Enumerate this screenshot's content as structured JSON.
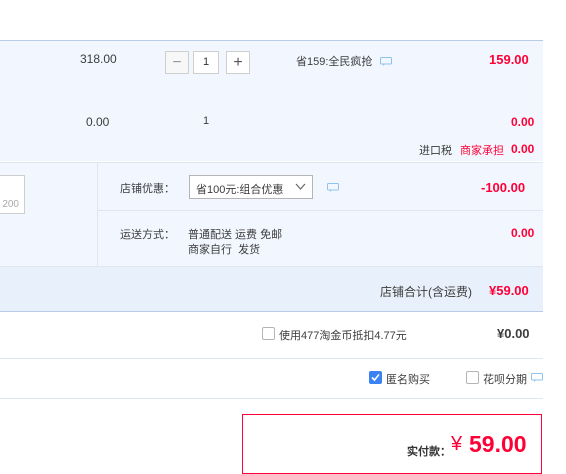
{
  "item1": {
    "orig_price": "318.00",
    "qty": "1",
    "promo": "省159:全民疯抢",
    "subtotal": "159.00"
  },
  "item2": {
    "price": "0.00",
    "qty": "1",
    "subtotal": "0.00",
    "tax_label": "进口税",
    "tax_note": "商家承担",
    "tax_value": "0.00"
  },
  "shop": {
    "partial_input_text": "200",
    "discount_label": "店铺优惠：",
    "discount_option": "省100元:组合优惠",
    "discount_value": "-100.00",
    "shipping_label": "运送方式：",
    "shipping_line1": "普通配送 运费 免邮",
    "shipping_line2": "商家自行  发货",
    "shipping_value": "0.00",
    "total_label": "店铺合计(含运费)",
    "total_value": "¥59.00"
  },
  "coins": {
    "label": "使用477淘金币抵扣4.77元",
    "value": "¥0.00"
  },
  "options": {
    "anonymous_label": "匿名购买",
    "anonymous_checked": true,
    "huabei_label": "花呗分期",
    "huabei_checked": false
  },
  "payment": {
    "label": "实付款：",
    "currency": "¥",
    "amount": "59.00"
  },
  "colors": {
    "accent_red": "#ff0036",
    "panel_blue": "#f2f7ff",
    "checkbox_blue": "#3b83f4"
  }
}
